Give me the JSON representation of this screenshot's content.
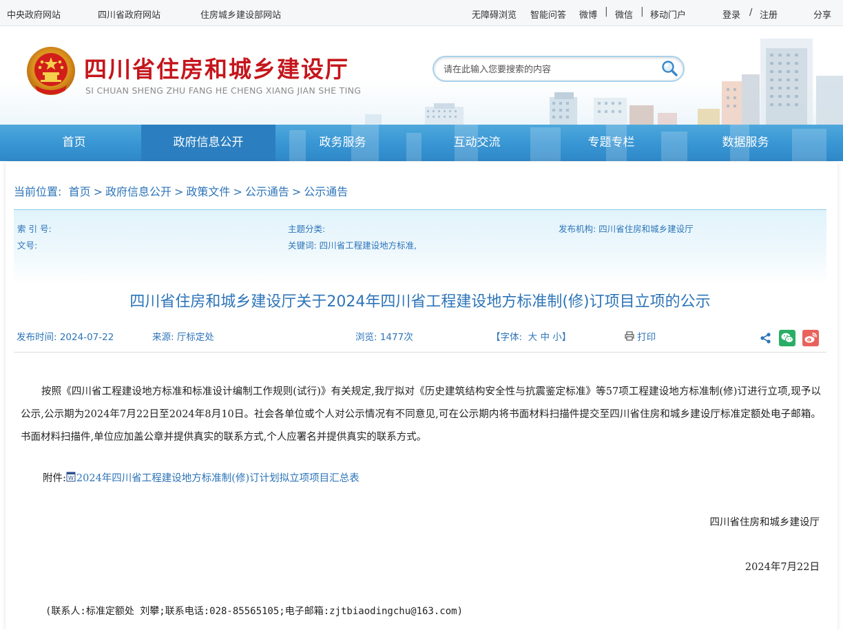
{
  "topbar": {
    "left_links": [
      "中央政府网站",
      "四川省政府网站",
      "住房城乡建设部网站"
    ],
    "right_links": {
      "accessible": "无障碍浏览",
      "smart_qa": "智能问答",
      "weibo": "微博",
      "wechat": "微信",
      "mobile": "移动门户",
      "login": "登录",
      "slash": "/",
      "register": "注册",
      "share": "分享"
    }
  },
  "header": {
    "title": "四川省住房和城乡建设厅",
    "pinyin": "SI CHUAN SHENG ZHU FANG HE CHENG XIANG JIAN SHE TING",
    "search_placeholder": "请在此输入您要搜索的内容"
  },
  "nav": {
    "items": [
      "首页",
      "政府信息公开",
      "政务服务",
      "互动交流",
      "专题专栏",
      "数据服务"
    ],
    "active_index": 1
  },
  "breadcrumb": {
    "label": "当前位置:",
    "items": [
      "首页",
      "政府信息公开",
      "政策文件",
      "公示通告",
      "公示通告"
    ],
    "separator": ">"
  },
  "meta": {
    "index_no": "索 引 号:",
    "doc_no": "文号:",
    "topic": "主题分类:",
    "keywords": "关键词:  四川省工程建设地方标准,",
    "publisher": "发布机构:  四川省住房和城乡建设厅"
  },
  "article": {
    "title": "四川省住房和城乡建设厅关于2024年四川省工程建设地方标准制(修)订项目立项的公示",
    "publish_time": "发布时间:  2024-07-22",
    "source": "来源:  厅标定处",
    "views": "浏览:  1477次",
    "font_label": "【字体:",
    "font_large": "大",
    "font_medium": "中",
    "font_small": "小",
    "font_end": "】",
    "print": "打印",
    "paragraph": "按照《四川省工程建设地方标准和标准设计编制工作规则(试行)》有关规定,我厅拟对《历史建筑结构安全性与抗震鉴定标准》等57项工程建设地方标准制(修)订进行立项,现予以公示,公示期为2024年7月22日至2024年8月10日。社会各单位或个人对公示情况有不同意见,可在公示期内将书面材料扫描件提交至四川省住房和城乡建设厅标准定额处电子邮箱。书面材料扫描件,单位应加盖公章并提供真实的联系方式,个人应署名并提供真实的联系方式。",
    "attachment_label": "附件:",
    "attachment_link": "2024年四川省工程建设地方标准制(修)订计划拟立项项目汇总表",
    "signature": "四川省住房和城乡建设厅",
    "date": "2024年7月22日",
    "contact": "(联系人:标准定额处 刘攀;联系电话:028-85565105;电子邮箱:zjtbiaodingchu@163.com)"
  },
  "colors": {
    "brand_red": "#c4161c",
    "nav_blue": "#3895d3",
    "link_blue": "#2d74b8",
    "wechat_green": "#2aae67",
    "weibo_red": "#e8635c"
  },
  "icons": [
    "national-emblem-icon",
    "search-icon",
    "print-icon",
    "share-icon",
    "wechat-icon",
    "weibo-icon",
    "word-doc-icon"
  ]
}
